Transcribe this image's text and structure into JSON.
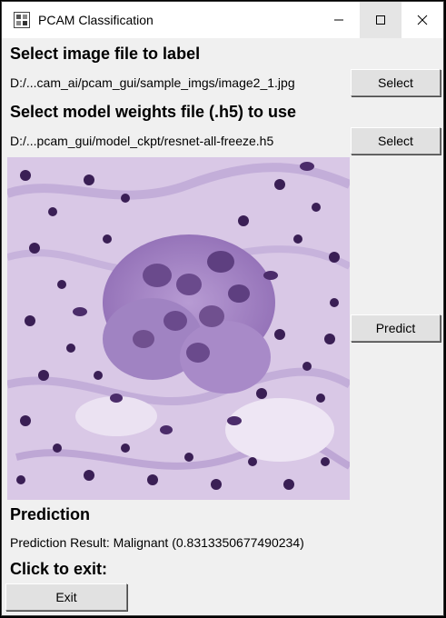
{
  "window": {
    "title": "PCAM Classification",
    "icons": {
      "app": "tk-feather-icon",
      "minimize": "minimize-icon",
      "maximize": "maximize-icon",
      "close": "close-icon"
    }
  },
  "image_section": {
    "heading": "Select image file to label",
    "path": "D:/...cam_ai/pcam_gui/sample_imgs/image2_1.jpg",
    "button": "Select"
  },
  "model_section": {
    "heading": "Select model weights file (.h5) to use",
    "path": "D:/...pcam_gui/model_ckpt/resnet-all-freeze.h5",
    "button": "Select"
  },
  "preview": {
    "predict_button": "Predict"
  },
  "prediction": {
    "heading": "Prediction",
    "result": "Prediction Result: Malignant (0.8313350677490234)"
  },
  "exit": {
    "heading": "Click to exit:",
    "button": "Exit"
  },
  "colors": {
    "window_bg": "#f0f0f0",
    "button_bg": "#e1e1e1",
    "tissue_bg": "#d9c8e6",
    "nucleus_dark": "#3a1f55",
    "nucleus_mid": "#6a4a8c"
  }
}
